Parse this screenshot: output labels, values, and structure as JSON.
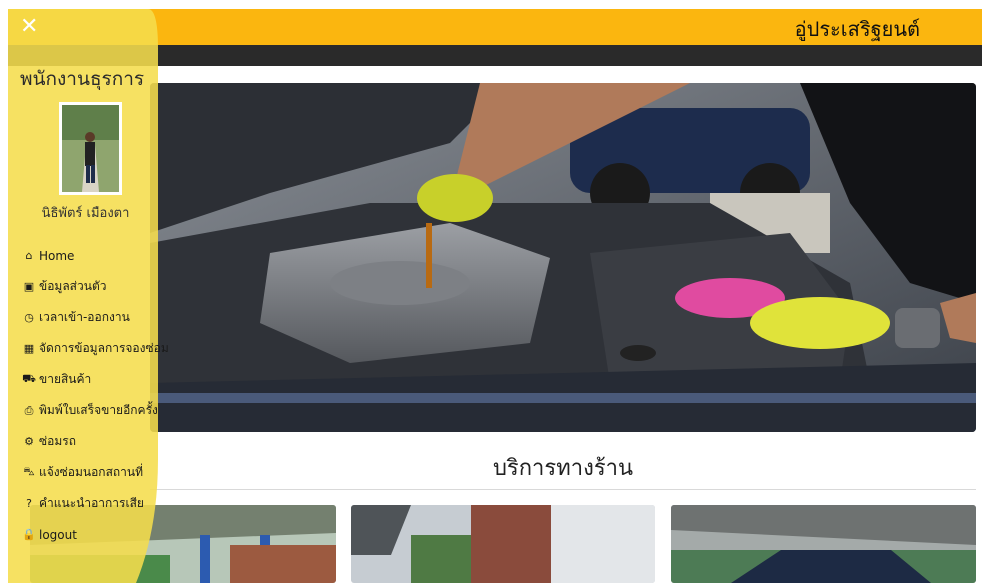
{
  "header": {
    "brand": "อู่ประเสริฐยนต์",
    "close_icon": "close-icon",
    "colors": {
      "accent": "#fbb60f",
      "dark_bar": "#2a2a2a"
    }
  },
  "sidebar": {
    "role_title": "พนักงานธุรการ",
    "user_name": "นิธิพัตร์ เมืองตา",
    "items": [
      {
        "label": "Home",
        "icon": "home-icon",
        "glyph": "⌂"
      },
      {
        "label": "ข้อมูลส่วนตัว",
        "icon": "id-card-icon",
        "glyph": "▣"
      },
      {
        "label": "เวลาเข้า-ออกงาน",
        "icon": "clock-icon",
        "glyph": "◷"
      },
      {
        "label": "จัดการข้อมูลการจองซ่อม",
        "icon": "calendar-icon",
        "glyph": "▦"
      },
      {
        "label": "ขายสินค้า",
        "icon": "cart-icon",
        "glyph": "⛟"
      },
      {
        "label": "พิมพ์ใบเสร็จขายอีกครั้ง",
        "icon": "printer-icon",
        "glyph": "⎙"
      },
      {
        "label": "ซ่อมรถ",
        "icon": "gears-icon",
        "glyph": "⚙"
      },
      {
        "label": "แจ้งซ่อมนอกสถานที่",
        "icon": "truck-icon",
        "glyph": "⛍"
      },
      {
        "label": "คำแนะนำอาการเสีย",
        "icon": "question-icon",
        "glyph": "?"
      },
      {
        "label": "logout",
        "icon": "lock-icon",
        "glyph": "🔒"
      }
    ]
  },
  "main": {
    "section_title": "บริการทางร้าน"
  }
}
